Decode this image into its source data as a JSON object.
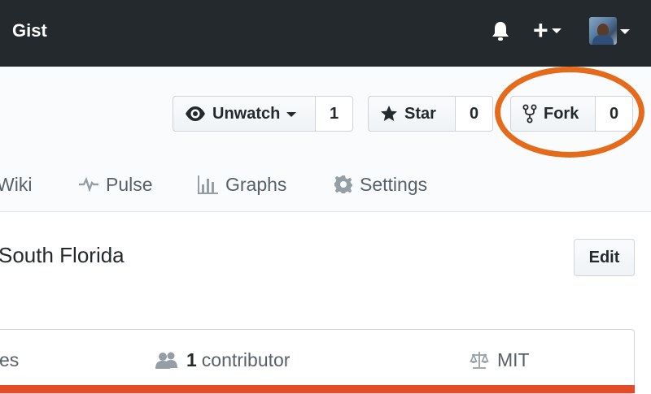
{
  "header": {
    "brand": "Gist",
    "icons": [
      "bell-icon",
      "plus-icon",
      "caret-down-icon"
    ]
  },
  "repo_actions": {
    "watch": {
      "label": "Unwatch",
      "count": "1"
    },
    "star": {
      "label": "Star",
      "count": "0"
    },
    "fork": {
      "label": "Fork",
      "count": "0"
    }
  },
  "tabs": [
    {
      "label": "Wiki"
    },
    {
      "label": "Pulse"
    },
    {
      "label": "Graphs"
    },
    {
      "label": "Settings"
    }
  ],
  "repo": {
    "description": "South Florida",
    "edit_label": "Edit"
  },
  "summary": {
    "left_fragment": "es",
    "contributors_count": "1",
    "contributors_label": "contributor",
    "license": "MIT"
  },
  "colors": {
    "header_bg": "#24292e",
    "highlight": "#e46b1c",
    "language_bar": "#e34c26"
  }
}
